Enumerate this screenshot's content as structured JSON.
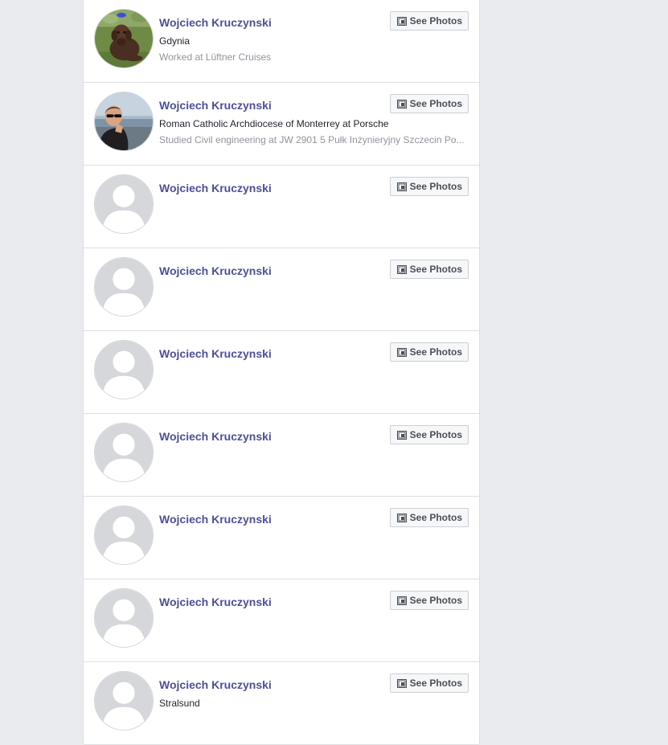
{
  "button_icon": "photos-icon",
  "see_photos_label": "See Photos",
  "people": [
    {
      "name": "Wojciech Kruczynski",
      "line1": "Gdynia",
      "line2": "Worked at Lüftner Cruises",
      "avatar": "dog-photo"
    },
    {
      "name": "Wojciech Kruczynski",
      "line1": "Roman Catholic Archdiocese of Monterrey at Porsche",
      "line2": "Studied Civil engineering at JW 2901 5 Pułk Inżynieryjny Szczecin Po...",
      "avatar": "man-photo"
    },
    {
      "name": "Wojciech Kruczynski",
      "line1": "",
      "line2": "",
      "avatar": "default"
    },
    {
      "name": "Wojciech Kruczynski",
      "line1": "",
      "line2": "",
      "avatar": "default"
    },
    {
      "name": "Wojciech Kruczynski",
      "line1": "",
      "line2": "",
      "avatar": "default"
    },
    {
      "name": "Wojciech Kruczynski",
      "line1": "",
      "line2": "",
      "avatar": "default"
    },
    {
      "name": "Wojciech Kruczynski",
      "line1": "",
      "line2": "",
      "avatar": "default"
    },
    {
      "name": "Wojciech Kruczynski",
      "line1": "",
      "line2": "",
      "avatar": "default"
    },
    {
      "name": "Wojciech Kruczynski",
      "line1": "Stralsund",
      "line2": "",
      "avatar": "default"
    }
  ]
}
